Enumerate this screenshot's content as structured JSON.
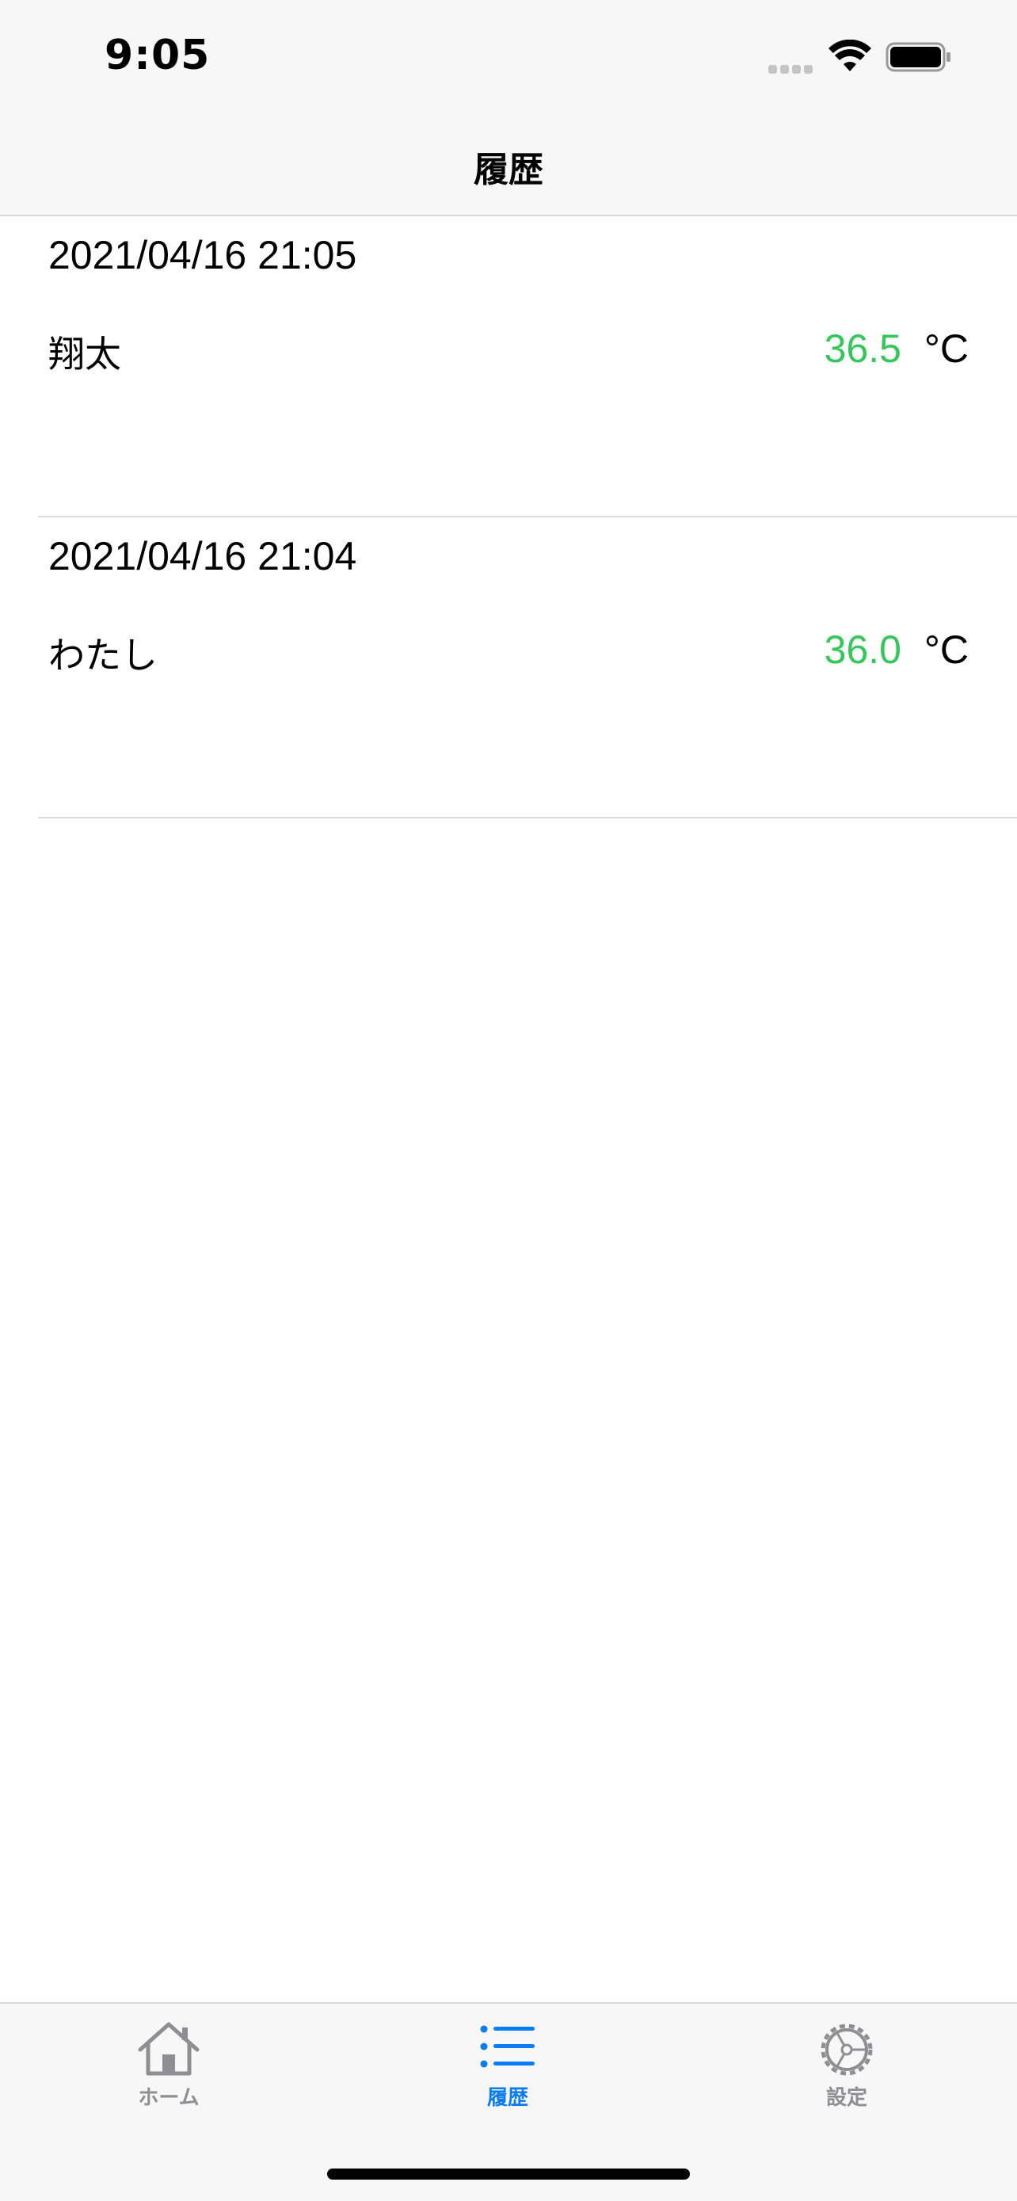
{
  "status_bar": {
    "time": "9:05"
  },
  "nav": {
    "title": "履歴"
  },
  "history": [
    {
      "datetime": "2021/04/16 21:05",
      "name": "翔太",
      "temperature": "36.5",
      "unit": "°C"
    },
    {
      "datetime": "2021/04/16 21:04",
      "name": "わたし",
      "temperature": "36.0",
      "unit": "°C"
    }
  ],
  "tabs": {
    "home": {
      "label": "ホーム",
      "icon": "house-icon"
    },
    "history": {
      "label": "履歴",
      "icon": "list-icon"
    },
    "settings": {
      "label": "設定",
      "icon": "gear-icon"
    }
  },
  "colors": {
    "accent": "#0a7cf6",
    "temperature_normal": "#34c759",
    "inactive_tab": "#8e8e93"
  }
}
